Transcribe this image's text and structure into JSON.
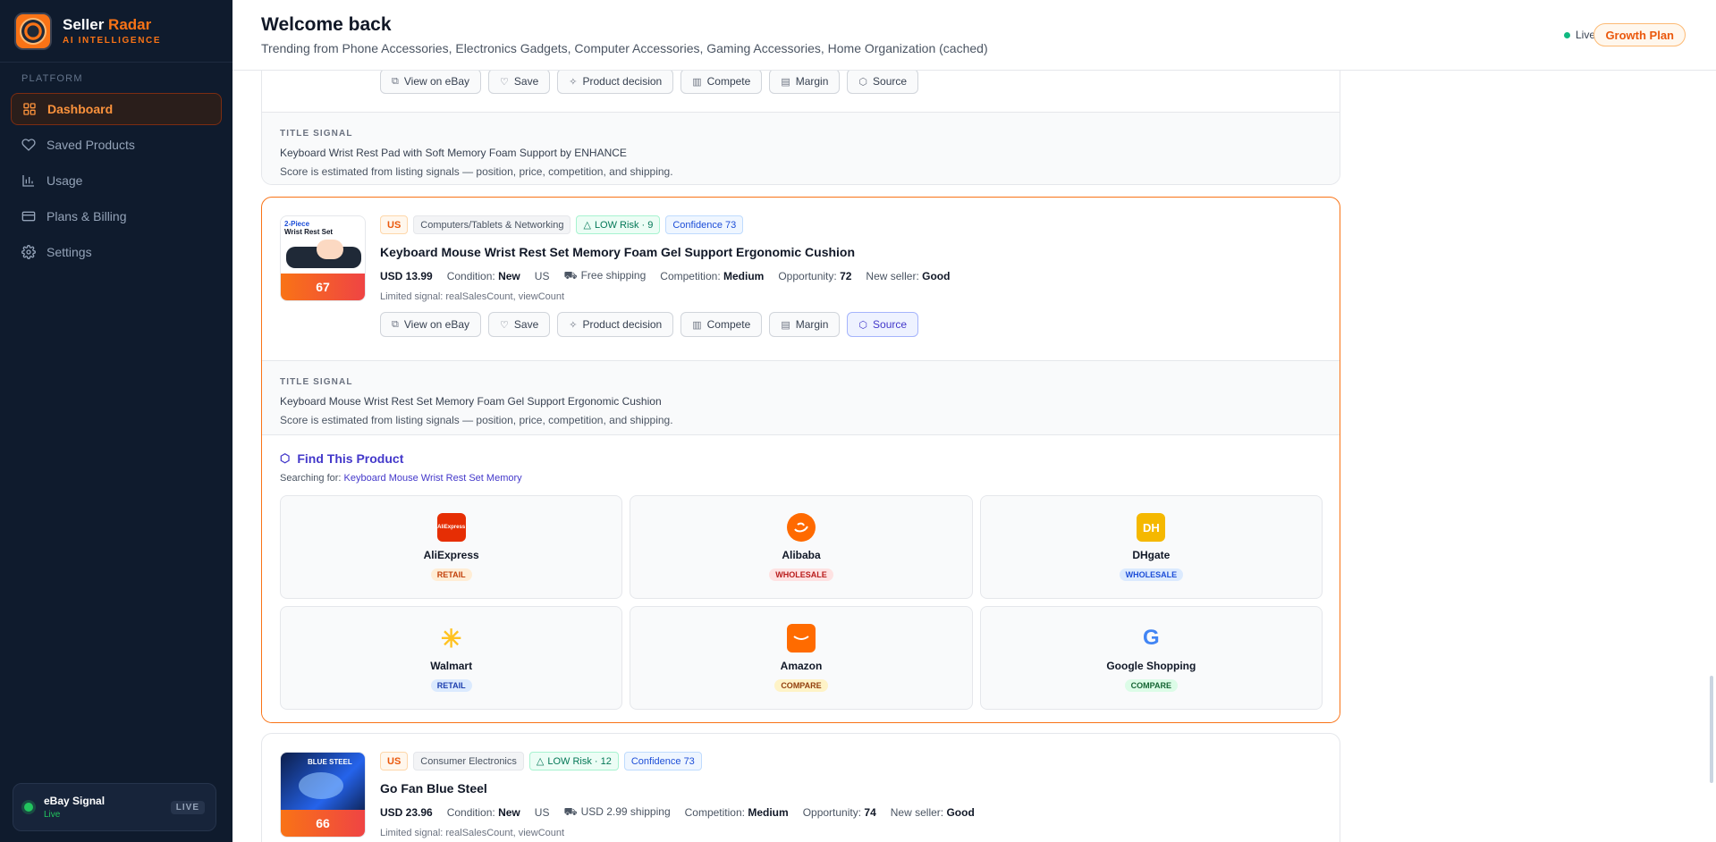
{
  "brand": {
    "name_1": "Seller",
    "name_2": "Radar",
    "sub": "AI INTELLIGENCE"
  },
  "sidebar": {
    "section": "PLATFORM",
    "items": [
      {
        "label": "Dashboard",
        "icon": "grid-icon"
      },
      {
        "label": "Saved Products",
        "icon": "heart-icon"
      },
      {
        "label": "Usage",
        "icon": "bar-chart-icon"
      },
      {
        "label": "Plans & Billing",
        "icon": "card-icon"
      },
      {
        "label": "Settings",
        "icon": "gear-icon"
      }
    ],
    "signal": {
      "title": "eBay Signal",
      "status": "Live",
      "badge": "LIVE"
    }
  },
  "header": {
    "title": "Welcome back",
    "subtitle": "Trending from Phone Accessories, Electronics Gadgets, Computer Accessories, Gaming Accessories, Home Organization (cached)",
    "live": "Live",
    "plan": "Growth Plan"
  },
  "buttons": {
    "view": "View on eBay",
    "save": "Save",
    "decision": "Product decision",
    "compete": "Compete",
    "margin": "Margin",
    "source": "Source"
  },
  "card1": {
    "signal_label": "TITLE SIGNAL",
    "signal_title": "Keyboard Wrist Rest Pad with Soft Memory Foam Support by ENHANCE",
    "signal_note": "Score is estimated from listing signals — position, price, competition, and shipping."
  },
  "card2": {
    "thumb_label_1": "2-Piece",
    "thumb_label_2": "Wrist Rest Set",
    "score": "67",
    "country": "US",
    "category": "Computers/Tablets & Networking",
    "risk": "LOW Risk · 9",
    "confidence": "Confidence 73",
    "title": "Keyboard Mouse Wrist Rest Set Memory Foam Gel Support Ergonomic Cushion",
    "price": "USD 13.99",
    "condition_label": "Condition:",
    "condition": "New",
    "location": "US",
    "shipping": "Free shipping",
    "competition_label": "Competition:",
    "competition": "Medium",
    "opportunity_label": "Opportunity:",
    "opportunity": "72",
    "newseller_label": "New seller:",
    "newseller": "Good",
    "limited": "Limited signal: realSalesCount, viewCount",
    "signal_label": "TITLE SIGNAL",
    "signal_title": "Keyboard Mouse Wrist Rest Set Memory Foam Gel Support Ergonomic Cushion",
    "signal_note": "Score is estimated from listing signals — position, price, competition, and shipping.",
    "find": {
      "title": "Find This Product",
      "searching_label": "Searching for:",
      "query": "Keyboard Mouse Wrist Rest Set Memory",
      "sources": [
        {
          "name": "AliExpress",
          "type": "RETAIL",
          "logo_text": "AliExpress"
        },
        {
          "name": "Alibaba",
          "type": "WHOLESALE",
          "logo_text": ""
        },
        {
          "name": "DHgate",
          "type": "WHOLESALE",
          "logo_text": "DH"
        },
        {
          "name": "Walmart",
          "type": "RETAIL",
          "logo_text": ""
        },
        {
          "name": "Amazon",
          "type": "COMPARE",
          "logo_text": ""
        },
        {
          "name": "Google Shopping",
          "type": "COMPARE",
          "logo_text": "G"
        }
      ]
    }
  },
  "card3": {
    "thumb_label": "BLUE STEEL",
    "score": "66",
    "country": "US",
    "category": "Consumer Electronics",
    "risk": "LOW Risk · 12",
    "confidence": "Confidence 73",
    "title": "Go Fan Blue Steel",
    "price": "USD 23.96",
    "condition_label": "Condition:",
    "condition": "New",
    "location": "US",
    "shipping": "USD 2.99 shipping",
    "competition_label": "Competition:",
    "competition": "Medium",
    "opportunity_label": "Opportunity:",
    "opportunity": "74",
    "newseller_label": "New seller:",
    "newseller": "Good",
    "limited": "Limited signal: realSalesCount, viewCount"
  },
  "colors": {
    "accent": "#f97316",
    "sidebar_bg": "#0f1b2d",
    "source_active": "#4338ca"
  }
}
